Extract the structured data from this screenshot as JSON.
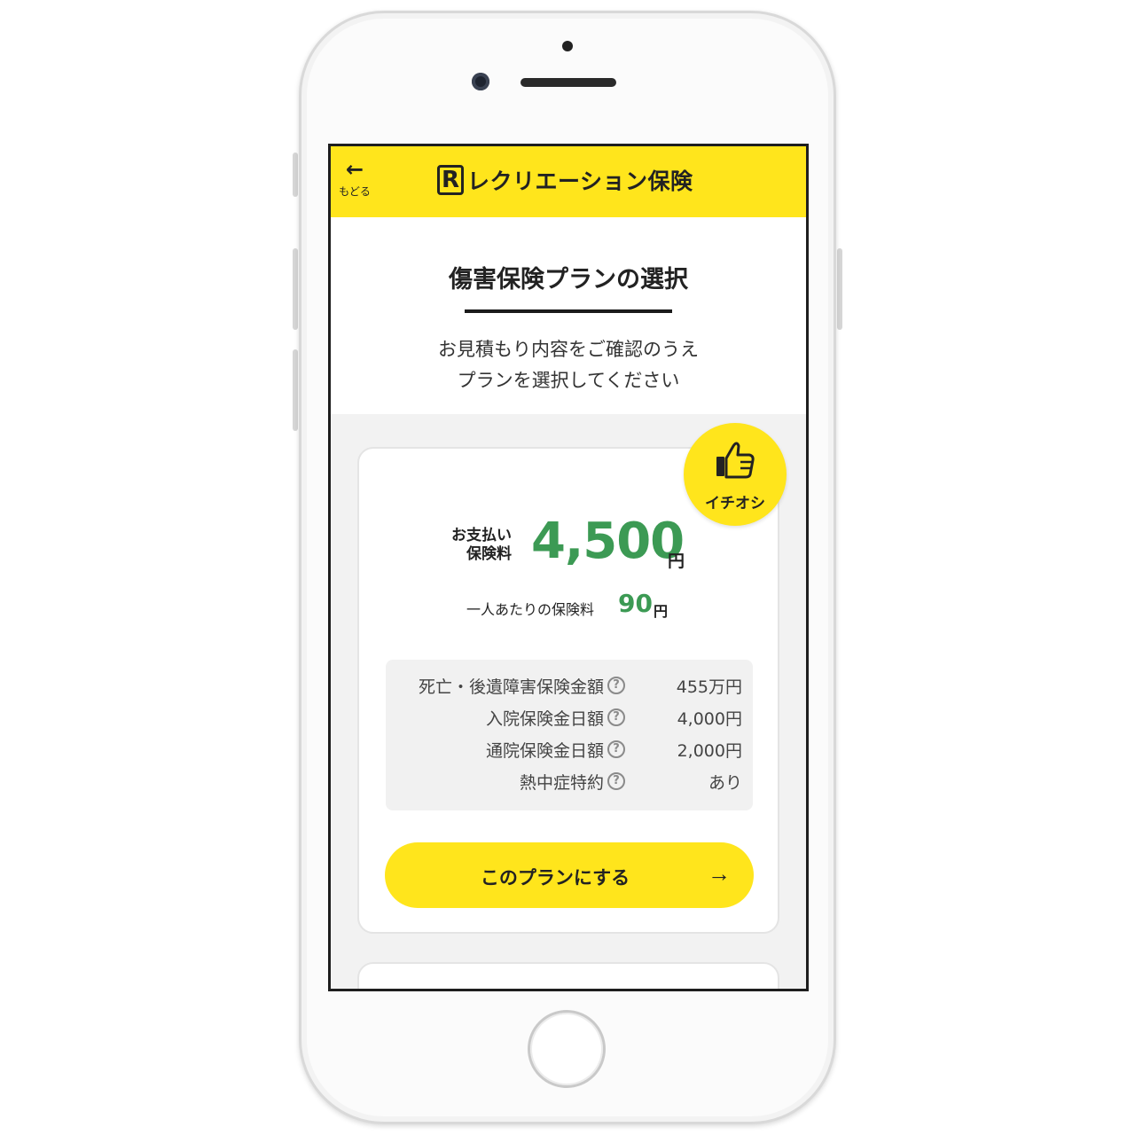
{
  "header": {
    "back_label": "もどる",
    "logo_letter": "R",
    "brand_name": "レクリエーション保険"
  },
  "intro": {
    "title": "傷害保険プランの選択",
    "subtitle_line1": "お見積もり内容をご確認のうえ",
    "subtitle_line2": "プランを選択してください"
  },
  "plan": {
    "badge_label": "イチオシ",
    "badge_icon": "thumbs-up-icon",
    "pay_label_line1": "お支払い",
    "pay_label_line2": "保険料",
    "pay_amount": "4,500",
    "pay_unit": "円",
    "per_person_label": "一人あたりの保険料",
    "per_person_amount": "90",
    "per_person_unit": "円",
    "coverage": [
      {
        "label": "死亡・後遺障害保険金額",
        "value": "455万円"
      },
      {
        "label": "入院保険金日額",
        "value": "4,000円"
      },
      {
        "label": "通院保険金日額",
        "value": "2,000円"
      },
      {
        "label": "熱中症特約",
        "value": "あり"
      }
    ],
    "help_glyph": "?",
    "select_button_label": "このプランにする",
    "select_button_arrow": "→"
  },
  "colors": {
    "accent_yellow": "#ffe51c",
    "price_green": "#3c9a54"
  }
}
